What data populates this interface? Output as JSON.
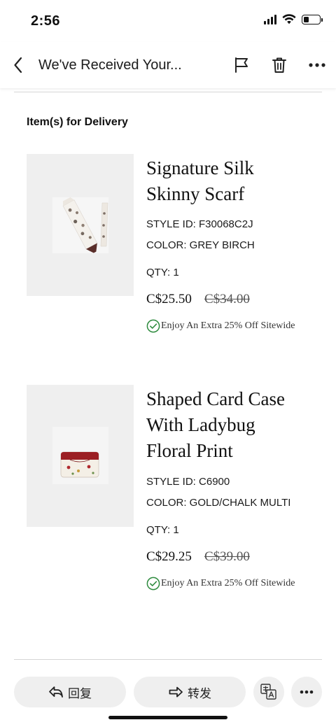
{
  "status_bar": {
    "time": "2:56",
    "battery_level": 0.35
  },
  "nav": {
    "title": "We've Received Your...",
    "icons": [
      "chevron-left-icon",
      "flag-icon",
      "trash-icon",
      "more-icon"
    ]
  },
  "email": {
    "section_title": "Item(s) for Delivery",
    "products": [
      {
        "name_line1": "Signature Silk",
        "name_line2": "Skinny Scarf",
        "style_id": "STYLE ID: F30068C2J",
        "color": "COLOR: GREY BIRCH",
        "qty": "QTY: 1",
        "price": "C$25.50",
        "original_price": "C$34.00",
        "promo": "Enjoy An Extra 25% Off Sitewide"
      },
      {
        "name_line1": "Shaped Card Case",
        "name_line2": "With Ladybug",
        "name_line3": "Floral Print",
        "style_id": "STYLE ID: C6900",
        "color": "COLOR: GOLD/CHALK MULTI",
        "qty": "QTY: 1",
        "price": "C$29.25",
        "original_price": "C$39.00",
        "promo": "Enjoy An Extra 25% Off Sitewide"
      }
    ]
  },
  "actions": {
    "reply_label": "回复",
    "forward_label": "转发",
    "icons": [
      "reply-icon",
      "forward-icon",
      "translate-icon",
      "more-icon"
    ]
  },
  "colors": {
    "check_green": "#2e8b3e",
    "pill_bg": "#efefef",
    "divider": "#d6d6d6"
  }
}
